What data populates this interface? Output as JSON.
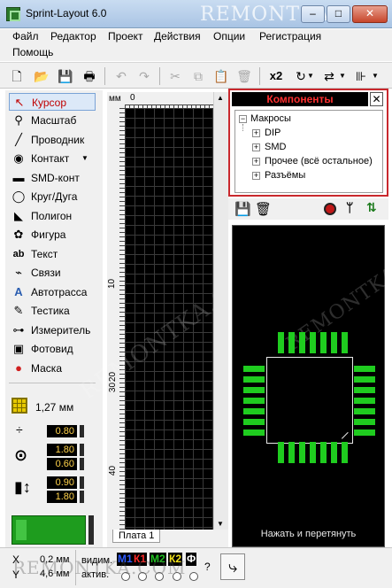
{
  "window": {
    "title": "Sprint-Layout 6.0",
    "minimize": "–",
    "maximize": "□",
    "close": "✕"
  },
  "watermark": "REMONTKA.COM",
  "menu": [
    "Файл",
    "Редактор",
    "Проект",
    "Действия",
    "Опции",
    "Регистрация",
    "Помощь"
  ],
  "toolbar": {
    "multiplier": "x2"
  },
  "tools": [
    {
      "label": "Курсор",
      "icon": "cursor-icon",
      "glyph": "↖",
      "active": true
    },
    {
      "label": "Масштаб",
      "icon": "zoom-icon",
      "glyph": "🔍"
    },
    {
      "label": "Проводник",
      "icon": "track-icon",
      "glyph": "╱"
    },
    {
      "label": "Контакт",
      "icon": "pad-icon",
      "glyph": "●"
    },
    {
      "label": "SMD-конт",
      "icon": "smd-pad-icon",
      "glyph": "▬"
    },
    {
      "label": "Круг/Дуга",
      "icon": "circle-arc-icon",
      "glyph": "◯"
    },
    {
      "label": "Полигон",
      "icon": "polygon-icon",
      "glyph": "◣"
    },
    {
      "label": "Фигура",
      "icon": "shape-icon",
      "glyph": "✿"
    },
    {
      "label": "Текст",
      "icon": "text-icon",
      "glyph": "ab|"
    },
    {
      "label": "Связи",
      "icon": "connections-icon",
      "glyph": "⌁"
    },
    {
      "label": "Автотрасса",
      "icon": "autoroute-icon",
      "glyph": "A"
    },
    {
      "label": "Тестика",
      "icon": "test-icon",
      "glyph": "✎"
    },
    {
      "label": "Измеритель",
      "icon": "measure-icon",
      "glyph": "⊶"
    },
    {
      "label": "Фотовид",
      "icon": "photoview-icon",
      "glyph": "📷"
    },
    {
      "label": "Маска",
      "icon": "mask-icon",
      "glyph": "●"
    }
  ],
  "grid": {
    "value": "1,27 мм"
  },
  "params": {
    "track_width": "0.80",
    "pad_outer": "1.80",
    "pad_inner": "0.60",
    "smd_width": "0.90",
    "smd_height": "1.80"
  },
  "ruler": {
    "unit": "мм",
    "top_zero": "0",
    "marks": [
      "0",
      "10",
      "20",
      "30",
      "40"
    ]
  },
  "tab": {
    "label": "Плата 1"
  },
  "components": {
    "title": "Компоненты",
    "close": "✕",
    "root": "Макросы",
    "children": [
      "DIP",
      "SMD",
      "Прочее (всё остальное)",
      "Разъёмы"
    ]
  },
  "preview": {
    "hint": "Нажать и перетянуть"
  },
  "status": {
    "x_label": "X",
    "y_label": "Y",
    "x_value": "0,2 мм",
    "y_value": "4,6 мм",
    "visible_label": "видим.",
    "active_label": "актив.",
    "layers": [
      {
        "name": "М1",
        "color": "#2f5cff"
      },
      {
        "name": "К1",
        "color": "#ff2a2a"
      },
      {
        "name": "М2",
        "color": "#21c021"
      },
      {
        "name": "К2",
        "color": "#f2e21a"
      },
      {
        "name": "Ф",
        "color": "#ffffff"
      }
    ],
    "help": "?"
  },
  "colors": {
    "highlight_border": "#c9282d",
    "pad_green": "#1fcc1f",
    "active_tool_text": "#c00000"
  }
}
